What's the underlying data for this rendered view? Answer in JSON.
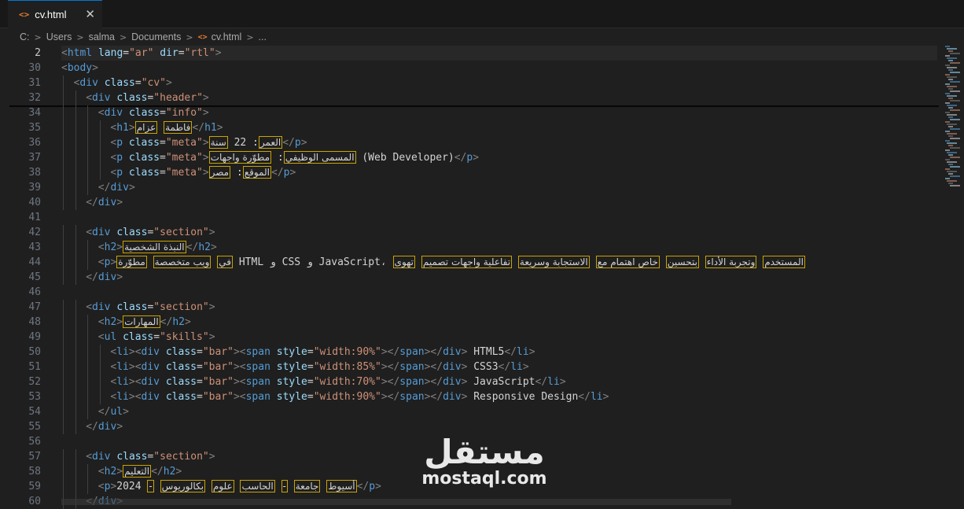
{
  "tab": {
    "icon": "code-icon",
    "label": "cv.html",
    "close": "✕"
  },
  "breadcrumb": [
    "C:",
    "Users",
    "salma",
    "Documents",
    "cv.html",
    "..."
  ],
  "watermark": {
    "arabic": "مستقل",
    "latin": "mostaql.com"
  },
  "lines": [
    {
      "n": "2",
      "ind": 0,
      "tokens": [
        [
          "t",
          "<"
        ],
        [
          "tn",
          "html"
        ],
        [
          "tx",
          " "
        ],
        [
          "an",
          "lang"
        ],
        [
          "tx",
          "="
        ],
        [
          "av",
          "\"ar\""
        ],
        [
          "tx",
          " "
        ],
        [
          "an",
          "dir"
        ],
        [
          "tx",
          "="
        ],
        [
          "av",
          "\"rtl\""
        ],
        [
          "t",
          ">"
        ]
      ]
    },
    {
      "n": "30",
      "ind": 0,
      "tokens": [
        [
          "t",
          "<"
        ],
        [
          "tn",
          "body"
        ],
        [
          "t",
          ">"
        ]
      ]
    },
    {
      "n": "31",
      "ind": 1,
      "tokens": [
        [
          "t",
          "<"
        ],
        [
          "tn",
          "div"
        ],
        [
          "tx",
          " "
        ],
        [
          "an",
          "class"
        ],
        [
          "tx",
          "="
        ],
        [
          "av",
          "\"cv\""
        ],
        [
          "t",
          ">"
        ]
      ]
    },
    {
      "n": "32",
      "ind": 2,
      "tokens": [
        [
          "t",
          "<"
        ],
        [
          "tn",
          "div"
        ],
        [
          "tx",
          " "
        ],
        [
          "an",
          "class"
        ],
        [
          "tx",
          "="
        ],
        [
          "av",
          "\"header\""
        ],
        [
          "t",
          ">"
        ]
      ]
    },
    {
      "n": "34",
      "ind": 3,
      "tokens": [
        [
          "t",
          "<"
        ],
        [
          "tn",
          "div"
        ],
        [
          "tx",
          " "
        ],
        [
          "an",
          "class"
        ],
        [
          "tx",
          "="
        ],
        [
          "av",
          "\"info\""
        ],
        [
          "t",
          ">"
        ]
      ]
    },
    {
      "n": "35",
      "ind": 4,
      "tokens": [
        [
          "t",
          "<"
        ],
        [
          "tn",
          "h1"
        ],
        [
          "t",
          ">"
        ],
        [
          "ar",
          "فاطمة"
        ],
        [
          "tx",
          " "
        ],
        [
          "ar",
          "عزام"
        ],
        [
          "t",
          "</"
        ],
        [
          "tn",
          "h1"
        ],
        [
          "t",
          ">"
        ]
      ]
    },
    {
      "n": "36",
      "ind": 4,
      "tokens": [
        [
          "t",
          "<"
        ],
        [
          "tn",
          "p"
        ],
        [
          "tx",
          " "
        ],
        [
          "an",
          "class"
        ],
        [
          "tx",
          "="
        ],
        [
          "av",
          "\"meta\""
        ],
        [
          "t",
          ">"
        ],
        [
          "ar",
          "العمر"
        ],
        [
          "tx",
          ": 22 "
        ],
        [
          "ar",
          "سنة"
        ],
        [
          "t",
          "</"
        ],
        [
          "tn",
          "p"
        ],
        [
          "t",
          ">"
        ]
      ]
    },
    {
      "n": "37",
      "ind": 4,
      "tokens": [
        [
          "t",
          "<"
        ],
        [
          "tn",
          "p"
        ],
        [
          "tx",
          " "
        ],
        [
          "an",
          "class"
        ],
        [
          "tx",
          "="
        ],
        [
          "av",
          "\"meta\""
        ],
        [
          "t",
          ">"
        ],
        [
          "ar",
          "المسمى الوظيفي"
        ],
        [
          "tx",
          ": "
        ],
        [
          "ar",
          "مطوّرة واجهات"
        ],
        [
          "tx",
          " (Web Developer)"
        ],
        [
          "t",
          "</"
        ],
        [
          "tn",
          "p"
        ],
        [
          "t",
          ">"
        ]
      ]
    },
    {
      "n": "38",
      "ind": 4,
      "tokens": [
        [
          "t",
          "<"
        ],
        [
          "tn",
          "p"
        ],
        [
          "tx",
          " "
        ],
        [
          "an",
          "class"
        ],
        [
          "tx",
          "="
        ],
        [
          "av",
          "\"meta\""
        ],
        [
          "t",
          ">"
        ],
        [
          "ar",
          "الموقع"
        ],
        [
          "tx",
          ": "
        ],
        [
          "ar",
          "مصر"
        ],
        [
          "t",
          "</"
        ],
        [
          "tn",
          "p"
        ],
        [
          "t",
          ">"
        ]
      ]
    },
    {
      "n": "39",
      "ind": 3,
      "tokens": [
        [
          "t",
          "</"
        ],
        [
          "tn",
          "div"
        ],
        [
          "t",
          ">"
        ]
      ]
    },
    {
      "n": "40",
      "ind": 2,
      "tokens": [
        [
          "t",
          "</"
        ],
        [
          "tn",
          "div"
        ],
        [
          "t",
          ">"
        ]
      ]
    },
    {
      "n": "41",
      "ind": 0,
      "tokens": []
    },
    {
      "n": "42",
      "ind": 2,
      "tokens": [
        [
          "t",
          "<"
        ],
        [
          "tn",
          "div"
        ],
        [
          "tx",
          " "
        ],
        [
          "an",
          "class"
        ],
        [
          "tx",
          "="
        ],
        [
          "av",
          "\"section\""
        ],
        [
          "t",
          ">"
        ]
      ]
    },
    {
      "n": "43",
      "ind": 3,
      "tokens": [
        [
          "t",
          "<"
        ],
        [
          "tn",
          "h2"
        ],
        [
          "t",
          ">"
        ],
        [
          "ar",
          "النبذة الشخصية"
        ],
        [
          "t",
          "</"
        ],
        [
          "tn",
          "h2"
        ],
        [
          "t",
          ">"
        ]
      ]
    },
    {
      "n": "44",
      "ind": 3,
      "tokens": [
        [
          "t",
          "<"
        ],
        [
          "tn",
          "p"
        ],
        [
          "t",
          ">"
        ],
        [
          "ar",
          "في"
        ],
        [
          "tx",
          " "
        ],
        [
          "ar",
          "ويب متخصصة"
        ],
        [
          "tx",
          " "
        ],
        [
          "ar",
          "مطوّرة"
        ],
        [
          "tx",
          " HTML و CSS و JavaScript، "
        ],
        [
          "ar",
          "المستخدم"
        ],
        [
          "tx",
          " "
        ],
        [
          "ar",
          "وتجربة الأداء"
        ],
        [
          "tx",
          " "
        ],
        [
          "ar",
          "بتحسين"
        ],
        [
          "tx",
          " "
        ],
        [
          "ar",
          "خاص اهتمام مع"
        ],
        [
          "tx",
          " "
        ],
        [
          "ar",
          "الاستجابة وسريعة"
        ],
        [
          "tx",
          " "
        ],
        [
          "ar",
          "تفاعلية واجهات تصميم"
        ],
        [
          "tx",
          " "
        ],
        [
          "ar",
          "تهوى"
        ]
      ]
    },
    {
      "n": "45",
      "ind": 2,
      "tokens": [
        [
          "t",
          "</"
        ],
        [
          "tn",
          "div"
        ],
        [
          "t",
          ">"
        ]
      ]
    },
    {
      "n": "46",
      "ind": 0,
      "tokens": []
    },
    {
      "n": "47",
      "ind": 2,
      "tokens": [
        [
          "t",
          "<"
        ],
        [
          "tn",
          "div"
        ],
        [
          "tx",
          " "
        ],
        [
          "an",
          "class"
        ],
        [
          "tx",
          "="
        ],
        [
          "av",
          "\"section\""
        ],
        [
          "t",
          ">"
        ]
      ]
    },
    {
      "n": "48",
      "ind": 3,
      "tokens": [
        [
          "t",
          "<"
        ],
        [
          "tn",
          "h2"
        ],
        [
          "t",
          ">"
        ],
        [
          "ar",
          "المهارات"
        ],
        [
          "t",
          "</"
        ],
        [
          "tn",
          "h2"
        ],
        [
          "t",
          ">"
        ]
      ]
    },
    {
      "n": "49",
      "ind": 3,
      "tokens": [
        [
          "t",
          "<"
        ],
        [
          "tn",
          "ul"
        ],
        [
          "tx",
          " "
        ],
        [
          "an",
          "class"
        ],
        [
          "tx",
          "="
        ],
        [
          "av",
          "\"skills\""
        ],
        [
          "t",
          ">"
        ]
      ]
    },
    {
      "n": "50",
      "ind": 4,
      "tokens": [
        [
          "t",
          "<"
        ],
        [
          "tn",
          "li"
        ],
        [
          "t",
          "><"
        ],
        [
          "tn",
          "div"
        ],
        [
          "tx",
          " "
        ],
        [
          "an",
          "class"
        ],
        [
          "tx",
          "="
        ],
        [
          "av",
          "\"bar\""
        ],
        [
          "t",
          "><"
        ],
        [
          "tn",
          "span"
        ],
        [
          "tx",
          " "
        ],
        [
          "an",
          "style"
        ],
        [
          "tx",
          "="
        ],
        [
          "av",
          "\"width:90%\""
        ],
        [
          "t",
          "></"
        ],
        [
          "tn",
          "span"
        ],
        [
          "t",
          "></"
        ],
        [
          "tn",
          "div"
        ],
        [
          "t",
          ">"
        ],
        [
          "tx",
          " HTML5"
        ],
        [
          "t",
          "</"
        ],
        [
          "tn",
          "li"
        ],
        [
          "t",
          ">"
        ]
      ]
    },
    {
      "n": "51",
      "ind": 4,
      "tokens": [
        [
          "t",
          "<"
        ],
        [
          "tn",
          "li"
        ],
        [
          "t",
          "><"
        ],
        [
          "tn",
          "div"
        ],
        [
          "tx",
          " "
        ],
        [
          "an",
          "class"
        ],
        [
          "tx",
          "="
        ],
        [
          "av",
          "\"bar\""
        ],
        [
          "t",
          "><"
        ],
        [
          "tn",
          "span"
        ],
        [
          "tx",
          " "
        ],
        [
          "an",
          "style"
        ],
        [
          "tx",
          "="
        ],
        [
          "av",
          "\"width:85%\""
        ],
        [
          "t",
          "></"
        ],
        [
          "tn",
          "span"
        ],
        [
          "t",
          "></"
        ],
        [
          "tn",
          "div"
        ],
        [
          "t",
          ">"
        ],
        [
          "tx",
          " CSS3"
        ],
        [
          "t",
          "</"
        ],
        [
          "tn",
          "li"
        ],
        [
          "t",
          ">"
        ]
      ]
    },
    {
      "n": "52",
      "ind": 4,
      "tokens": [
        [
          "t",
          "<"
        ],
        [
          "tn",
          "li"
        ],
        [
          "t",
          "><"
        ],
        [
          "tn",
          "div"
        ],
        [
          "tx",
          " "
        ],
        [
          "an",
          "class"
        ],
        [
          "tx",
          "="
        ],
        [
          "av",
          "\"bar\""
        ],
        [
          "t",
          "><"
        ],
        [
          "tn",
          "span"
        ],
        [
          "tx",
          " "
        ],
        [
          "an",
          "style"
        ],
        [
          "tx",
          "="
        ],
        [
          "av",
          "\"width:70%\""
        ],
        [
          "t",
          "></"
        ],
        [
          "tn",
          "span"
        ],
        [
          "t",
          "></"
        ],
        [
          "tn",
          "div"
        ],
        [
          "t",
          ">"
        ],
        [
          "tx",
          " JavaScript"
        ],
        [
          "t",
          "</"
        ],
        [
          "tn",
          "li"
        ],
        [
          "t",
          ">"
        ]
      ]
    },
    {
      "n": "53",
      "ind": 4,
      "tokens": [
        [
          "t",
          "<"
        ],
        [
          "tn",
          "li"
        ],
        [
          "t",
          "><"
        ],
        [
          "tn",
          "div"
        ],
        [
          "tx",
          " "
        ],
        [
          "an",
          "class"
        ],
        [
          "tx",
          "="
        ],
        [
          "av",
          "\"bar\""
        ],
        [
          "t",
          "><"
        ],
        [
          "tn",
          "span"
        ],
        [
          "tx",
          " "
        ],
        [
          "an",
          "style"
        ],
        [
          "tx",
          "="
        ],
        [
          "av",
          "\"width:90%\""
        ],
        [
          "t",
          "></"
        ],
        [
          "tn",
          "span"
        ],
        [
          "t",
          "></"
        ],
        [
          "tn",
          "div"
        ],
        [
          "t",
          ">"
        ],
        [
          "tx",
          " Responsive Design"
        ],
        [
          "t",
          "</"
        ],
        [
          "tn",
          "li"
        ],
        [
          "t",
          ">"
        ]
      ]
    },
    {
      "n": "54",
      "ind": 3,
      "tokens": [
        [
          "t",
          "</"
        ],
        [
          "tn",
          "ul"
        ],
        [
          "t",
          ">"
        ]
      ]
    },
    {
      "n": "55",
      "ind": 2,
      "tokens": [
        [
          "t",
          "</"
        ],
        [
          "tn",
          "div"
        ],
        [
          "t",
          ">"
        ]
      ]
    },
    {
      "n": "56",
      "ind": 0,
      "tokens": []
    },
    {
      "n": "57",
      "ind": 2,
      "tokens": [
        [
          "t",
          "<"
        ],
        [
          "tn",
          "div"
        ],
        [
          "tx",
          " "
        ],
        [
          "an",
          "class"
        ],
        [
          "tx",
          "="
        ],
        [
          "av",
          "\"section\""
        ],
        [
          "t",
          ">"
        ]
      ]
    },
    {
      "n": "58",
      "ind": 3,
      "tokens": [
        [
          "t",
          "<"
        ],
        [
          "tn",
          "h2"
        ],
        [
          "t",
          ">"
        ],
        [
          "ar",
          "التعليم"
        ],
        [
          "t",
          "</"
        ],
        [
          "tn",
          "h2"
        ],
        [
          "t",
          ">"
        ]
      ]
    },
    {
      "n": "59",
      "ind": 3,
      "tokens": [
        [
          "t",
          "<"
        ],
        [
          "tn",
          "p"
        ],
        [
          "t",
          ">"
        ],
        [
          "tx",
          "2024 "
        ],
        [
          "ar",
          "-"
        ],
        [
          "tx",
          " "
        ],
        [
          "ar",
          "أسيوط"
        ],
        [
          "tx",
          " "
        ],
        [
          "ar",
          "جامعة"
        ],
        [
          "tx",
          " "
        ],
        [
          "ar",
          "-"
        ],
        [
          "tx",
          " "
        ],
        [
          "ar",
          "الحاسب"
        ],
        [
          "tx",
          " "
        ],
        [
          "ar",
          "علوم"
        ],
        [
          "tx",
          " "
        ],
        [
          "ar",
          "بكالوريوس"
        ],
        [
          "t",
          "</"
        ],
        [
          "tn",
          "p"
        ],
        [
          "t",
          ">"
        ]
      ]
    },
    {
      "n": "60",
      "ind": 2,
      "tokens": [
        [
          "t",
          "</"
        ],
        [
          "tn",
          "div"
        ],
        [
          "t",
          ">"
        ]
      ]
    }
  ]
}
